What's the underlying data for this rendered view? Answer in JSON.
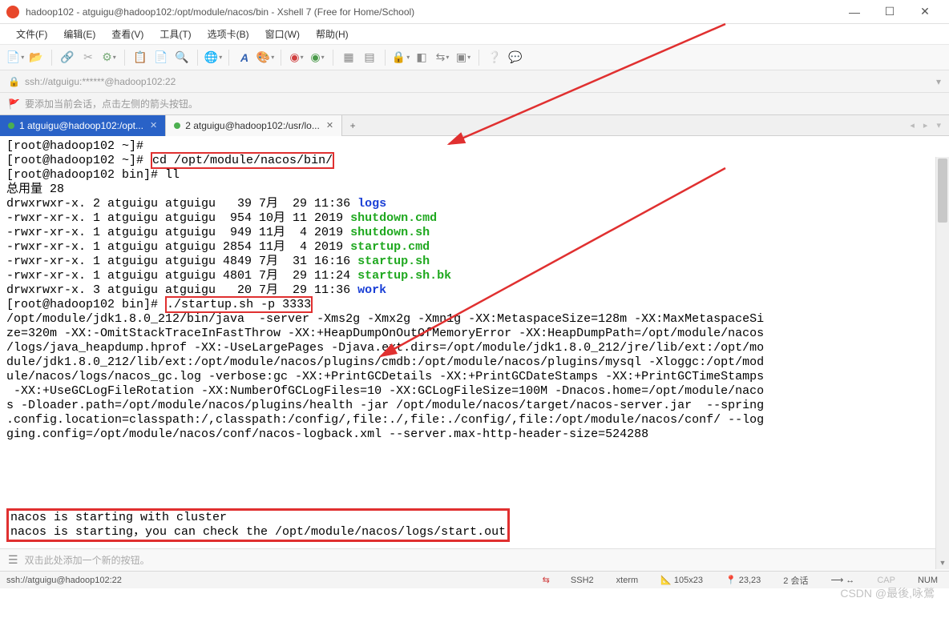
{
  "window": {
    "title": "hadoop102 - atguigu@hadoop102:/opt/module/nacos/bin - Xshell 7 (Free for Home/School)"
  },
  "menu": {
    "items": [
      "文件(F)",
      "编辑(E)",
      "查看(V)",
      "工具(T)",
      "选项卡(B)",
      "窗口(W)",
      "帮助(H)"
    ]
  },
  "address": {
    "url": "ssh://atguigu:******@hadoop102:22"
  },
  "hint": {
    "text": "要添加当前会话，点击左侧的箭头按钮。"
  },
  "tabs": {
    "items": [
      {
        "label": "1 atguigu@hadoop102:/opt...",
        "active": true
      },
      {
        "label": "2 atguigu@hadoop102:/usr/lo...",
        "active": false
      }
    ]
  },
  "terminal": {
    "lines": [
      {
        "t": "[root@hadoop102 ~]#"
      },
      {
        "prefix": "[root@hadoop102 ~]# ",
        "boxed": "cd /opt/module/nacos/bin/"
      },
      {
        "t": "[root@hadoop102 bin]# ll"
      },
      {
        "t": "总用量 28"
      },
      {
        "prefix": "drwxrwxr-x. 2 atguigu atguigu   39 7月  29 11:36 ",
        "colored": "logs",
        "cls": "blue"
      },
      {
        "prefix": "-rwxr-xr-x. 1 atguigu atguigu  954 10月 11 2019 ",
        "colored": "shutdown.cmd",
        "cls": "green"
      },
      {
        "prefix": "-rwxr-xr-x. 1 atguigu atguigu  949 11月  4 2019 ",
        "colored": "shutdown.sh",
        "cls": "green"
      },
      {
        "prefix": "-rwxr-xr-x. 1 atguigu atguigu 2854 11月  4 2019 ",
        "colored": "startup.cmd",
        "cls": "green"
      },
      {
        "prefix": "-rwxr-xr-x. 1 atguigu atguigu 4849 7月  31 16:16 ",
        "colored": "startup.sh",
        "cls": "green"
      },
      {
        "prefix": "-rwxr-xr-x. 1 atguigu atguigu 4801 7月  29 11:24 ",
        "colored": "startup.sh.bk",
        "cls": "green"
      },
      {
        "prefix": "drwxrwxr-x. 3 atguigu atguigu   20 7月  29 11:36 ",
        "colored": "work",
        "cls": "blue"
      },
      {
        "prefix": "[root@hadoop102 bin]# ",
        "boxed": "./startup.sh -p 3333"
      },
      {
        "t": "/opt/module/jdk1.8.0_212/bin/java  -server -Xms2g -Xmx2g -Xmn1g -XX:MetaspaceSize=128m -XX:MaxMetaspaceSi"
      },
      {
        "t": "ze=320m -XX:-OmitStackTraceInFastThrow -XX:+HeapDumpOnOutOfMemoryError -XX:HeapDumpPath=/opt/module/nacos"
      },
      {
        "t": "/logs/java_heapdump.hprof -XX:-UseLargePages -Djava.ext.dirs=/opt/module/jdk1.8.0_212/jre/lib/ext:/opt/mo"
      },
      {
        "t": "dule/jdk1.8.0_212/lib/ext:/opt/module/nacos/plugins/cmdb:/opt/module/nacos/plugins/mysql -Xloggc:/opt/mod"
      },
      {
        "t": "ule/nacos/logs/nacos_gc.log -verbose:gc -XX:+PrintGCDetails -XX:+PrintGCDateStamps -XX:+PrintGCTimeStamps"
      },
      {
        "t": " -XX:+UseGCLogFileRotation -XX:NumberOfGCLogFiles=10 -XX:GCLogFileSize=100M -Dnacos.home=/opt/module/naco"
      },
      {
        "t": "s -Dloader.path=/opt/module/nacos/plugins/health -jar /opt/module/nacos/target/nacos-server.jar  --spring"
      },
      {
        "t": ".config.location=classpath:/,classpath:/config/,file:./,file:./config/,file:/opt/module/nacos/conf/ --log"
      },
      {
        "t": "ging.config=/opt/module/nacos/conf/nacos-logback.xml --server.max-http-header-size=524288"
      }
    ],
    "nacos1": "nacos is starting with cluster",
    "nacos2": "nacos is starting，you can check the /opt/module/nacos/logs/start.out"
  },
  "addbtn": {
    "text": "双击此处添加一个新的按钮。"
  },
  "status": {
    "left": "ssh://atguigu@hadoop102:22",
    "ssh": "SSH2",
    "term": "xterm",
    "size": "105x23",
    "cursor": "23,23",
    "sessions": "2 会话",
    "caps": "CAP",
    "num": "NUM"
  },
  "watermark": "CSDN @最後,咏鶯"
}
